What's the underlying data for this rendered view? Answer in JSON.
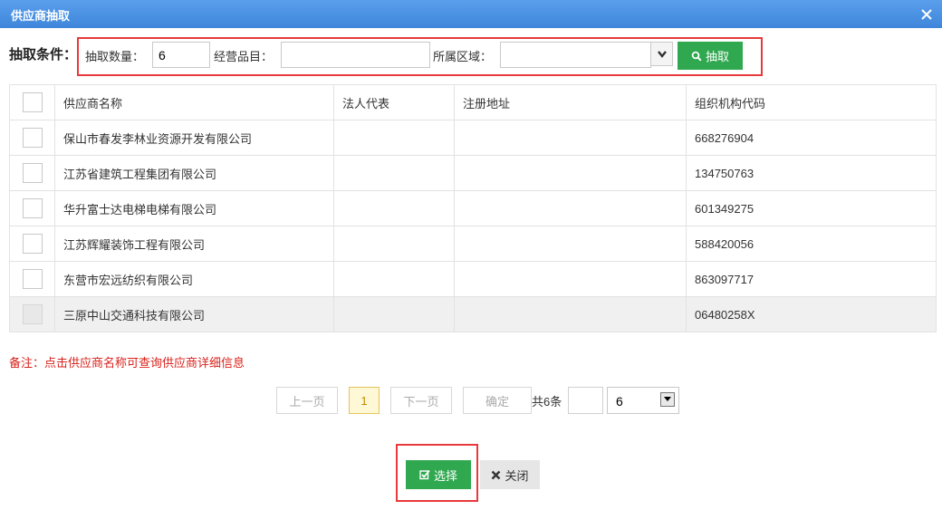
{
  "dialog": {
    "title": "供应商抽取",
    "close_icon": "close-icon"
  },
  "filter": {
    "label": "抽取条件：",
    "count_label": "抽取数量：",
    "count_value": "6",
    "category_label": "经营品目：",
    "category_value": "",
    "region_label": "所属区域：",
    "region_value": "",
    "extract_button": "抽取",
    "colors": {
      "highlight_border": "#e8393c",
      "primary": "#2fa84f"
    }
  },
  "table": {
    "headers": [
      "供应商名称",
      "法人代表",
      "注册地址",
      "组织机构代码"
    ],
    "rows": [
      {
        "name": "保山市春发李林业资源开发有限公司",
        "legal": "",
        "address": "",
        "code": "668276904"
      },
      {
        "name": "江苏省建筑工程集团有限公司",
        "legal": "",
        "address": "",
        "code": "134750763"
      },
      {
        "name": "华升富士达电梯电梯有限公司",
        "legal": "",
        "address": "",
        "code": "601349275"
      },
      {
        "name": "江苏辉耀装饰工程有限公司",
        "legal": "",
        "address": "",
        "code": "588420056"
      },
      {
        "name": "东营市宏远纺织有限公司",
        "legal": "",
        "address": "",
        "code": "863097717"
      },
      {
        "name": "三原中山交通科技有限公司",
        "legal": "",
        "address": "",
        "code": "06480258X"
      }
    ]
  },
  "note": "备注：点击供应商名称可查询供应商详细信息",
  "pagination": {
    "prev": "上一页",
    "current_page": "1",
    "next": "下一页",
    "confirm": "确定",
    "total": "共6条",
    "goto_value": "",
    "page_size": "6"
  },
  "actions": {
    "select": "选择",
    "close": "关闭"
  }
}
